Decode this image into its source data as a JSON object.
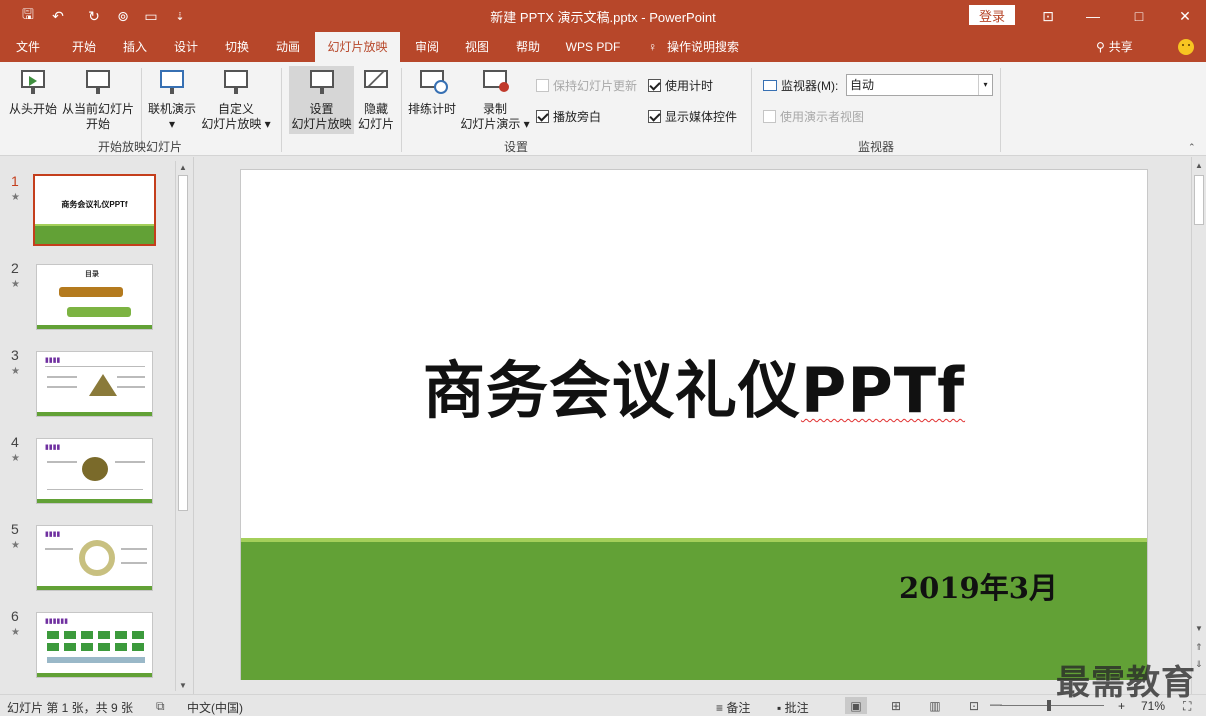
{
  "window": {
    "title": "新建 PPTX 演示文稿.pptx  -  PowerPoint",
    "login_label": "登录",
    "minimize": "—",
    "restore": "□",
    "close": "✕",
    "ribbon_display": "⊡"
  },
  "quick_access": {
    "save": "🖫",
    "undo": "↶",
    "redo": "↻",
    "customize": "⇣"
  },
  "tabs": [
    {
      "label": "文件"
    },
    {
      "label": "开始"
    },
    {
      "label": "插入"
    },
    {
      "label": "设计"
    },
    {
      "label": "切换"
    },
    {
      "label": "动画"
    },
    {
      "label": "幻灯片放映",
      "active": true
    },
    {
      "label": "审阅"
    },
    {
      "label": "视图"
    },
    {
      "label": "帮助"
    },
    {
      "label": "WPS PDF"
    }
  ],
  "tell_me": "操作说明搜索",
  "share_label": "共享",
  "ribbon": {
    "start_group": {
      "label": "开始放映幻灯片",
      "from_beginning": "从头开始",
      "from_current_line1": "从当前幻灯片",
      "from_current_line2": "开始",
      "online_present": "联机演示",
      "custom_show_line1": "自定义",
      "custom_show_line2": "幻灯片放映"
    },
    "setup_group": {
      "label": "设置",
      "setup_show_line1": "设置",
      "setup_show_line2": "幻灯片放映",
      "hide_slide_line1": "隐藏",
      "hide_slide_line2": "幻灯片",
      "rehearse_timings": "排练计时",
      "record_line1": "录制",
      "record_line2": "幻灯片演示",
      "keep_updated": "保持幻灯片更新",
      "play_narrations": "播放旁白",
      "use_timings": "使用计时",
      "show_media_controls": "显示媒体控件"
    },
    "monitor_group": {
      "label": "监视器",
      "monitor_label": "监视器(M):",
      "monitor_value": "自动",
      "presenter_view": "使用演示者视图"
    }
  },
  "thumbnails": [
    {
      "num": "1",
      "title": "商务会议礼仪PPTf"
    },
    {
      "num": "2",
      "title": "目录"
    },
    {
      "num": "3",
      "title": ""
    },
    {
      "num": "4",
      "title": ""
    },
    {
      "num": "5",
      "title": ""
    },
    {
      "num": "6",
      "title": ""
    }
  ],
  "slide": {
    "title_main": "商务会议礼仪",
    "title_tail": "PPTf",
    "date": "2019年3月"
  },
  "status": {
    "slide_count": "幻灯片 第 1 张，共 9 张",
    "language": "中文(中国)",
    "notes": "备注",
    "comments": "批注",
    "zoom_minus": "—",
    "zoom_plus": "+",
    "zoom": "71%"
  },
  "watermark": "最需教育",
  "colors": {
    "accent": "#b7472a",
    "slide_band": "#62a136",
    "thumb_active": "#c43e1c"
  }
}
